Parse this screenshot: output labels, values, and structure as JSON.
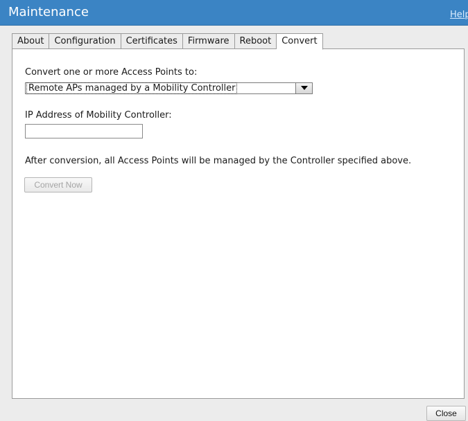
{
  "window": {
    "title": "Maintenance",
    "help_link": "Help"
  },
  "tabs": [
    {
      "label": "About",
      "active": false
    },
    {
      "label": "Configuration",
      "active": false
    },
    {
      "label": "Certificates",
      "active": false
    },
    {
      "label": "Firmware",
      "active": false
    },
    {
      "label": "Reboot",
      "active": false
    },
    {
      "label": "Convert",
      "active": true
    }
  ],
  "convert": {
    "convert_label": "Convert one or more Access Points to:",
    "mode_select": {
      "selected": "Remote APs managed by a Mobility Controller"
    },
    "ip_label": "IP Address of Mobility Controller:",
    "ip_value": "",
    "info_text": "After conversion, all Access Points will be managed by the Controller specified above.",
    "convert_button": "Convert Now",
    "convert_button_enabled": false
  },
  "footer": {
    "close_button": "Close"
  },
  "colors": {
    "titlebar": "#3b84c4",
    "panel_background": "#ffffff",
    "window_background": "#ececec",
    "disabled_text": "#a4a4a4"
  },
  "icons": {
    "dropdown": "triangle-down"
  }
}
